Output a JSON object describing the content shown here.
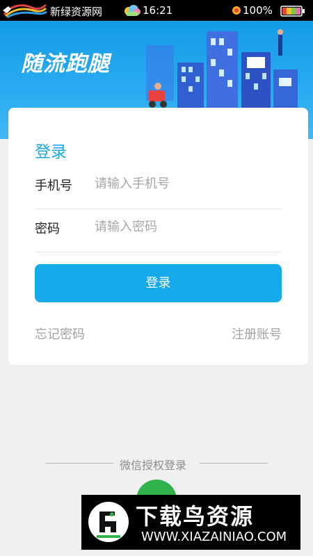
{
  "status_bar": {
    "site_name": "新绿资源网",
    "time": "16:21",
    "battery": "100%"
  },
  "banner": {
    "title": "随流跑腿"
  },
  "login_card": {
    "title": "登录",
    "phone_label": "手机号",
    "phone_placeholder": "请输入手机号",
    "phone_value": "",
    "password_label": "密码",
    "password_placeholder": "请输入密码",
    "password_value": "",
    "login_button": "登录",
    "forgot_password": "忘记密码",
    "register": "注册账号"
  },
  "wechat": {
    "label": "微信授权登录"
  },
  "watermark": {
    "title": "下载鸟资源",
    "url": "WWW.XIAZAINIAO.COM"
  },
  "colors": {
    "accent": "#16aaea",
    "banner": "#139ce6",
    "wechat": "#2fb24a",
    "page_bg": "#f0f0f0"
  }
}
